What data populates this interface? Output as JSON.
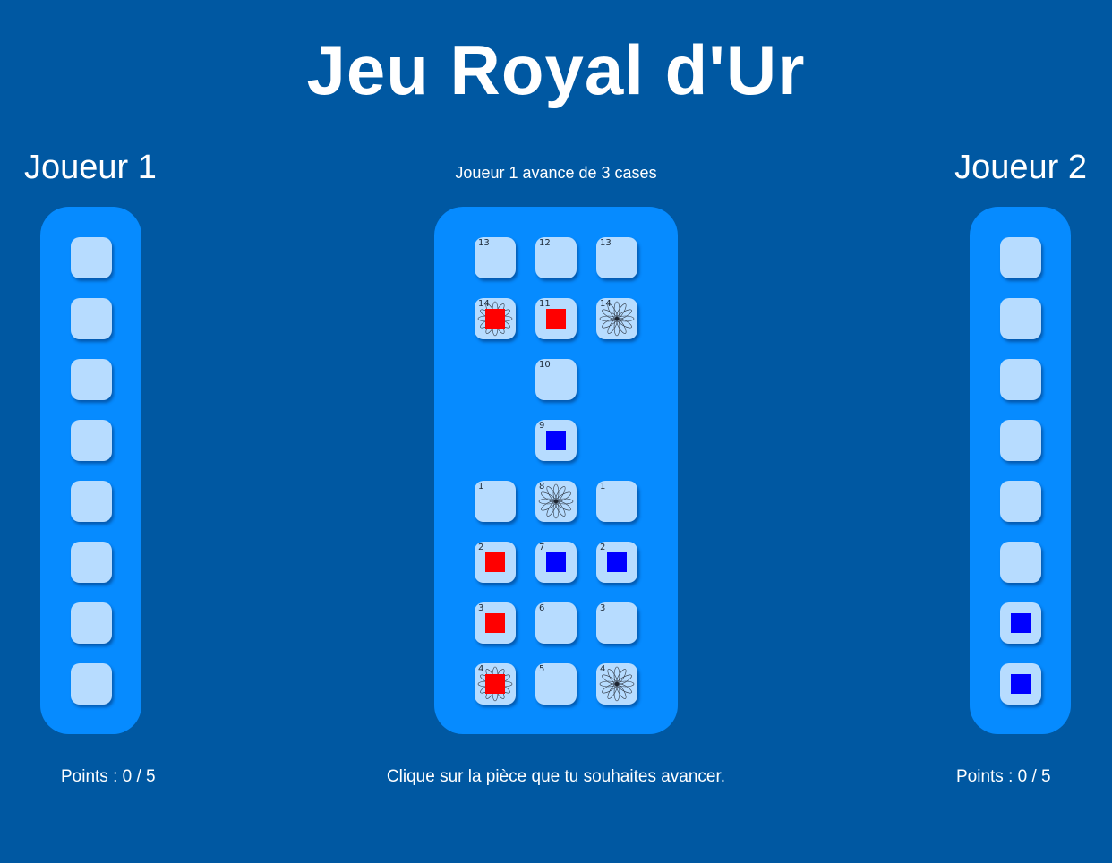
{
  "title": "Jeu Royal d'Ur",
  "status": "Joueur 1 avance de 3 cases",
  "hint": "Clique sur la pièce que tu souhaites avancer.",
  "colors": {
    "background": "#0058a2",
    "panel": "#068bff",
    "cell": "#b7dcff",
    "player1_piece": "#ff0000",
    "player2_piece": "#0000ff"
  },
  "players": [
    {
      "name": "Joueur 1",
      "points_label": "Points : 0 / 5",
      "reserve": [
        "empty",
        "empty",
        "empty",
        "empty",
        "empty",
        "empty",
        "empty",
        "empty"
      ]
    },
    {
      "name": "Joueur 2",
      "points_label": "Points : 0 / 5",
      "reserve": [
        "empty",
        "empty",
        "empty",
        "empty",
        "empty",
        "empty",
        "blue",
        "blue"
      ]
    }
  ],
  "board": {
    "rows": [
      [
        {
          "num": "13",
          "rosette": false,
          "piece": null
        },
        {
          "num": "12",
          "rosette": false,
          "piece": null
        },
        {
          "num": "13",
          "rosette": false,
          "piece": null
        }
      ],
      [
        {
          "num": "14",
          "rosette": true,
          "piece": "red"
        },
        {
          "num": "11",
          "rosette": false,
          "piece": "red"
        },
        {
          "num": "14",
          "rosette": true,
          "piece": null
        }
      ],
      [
        null,
        {
          "num": "10",
          "rosette": false,
          "piece": null
        },
        null
      ],
      [
        null,
        {
          "num": "9",
          "rosette": false,
          "piece": "blue"
        },
        null
      ],
      [
        {
          "num": "1",
          "rosette": false,
          "piece": null
        },
        {
          "num": "8",
          "rosette": true,
          "piece": null
        },
        {
          "num": "1",
          "rosette": false,
          "piece": null
        }
      ],
      [
        {
          "num": "2",
          "rosette": false,
          "piece": "red"
        },
        {
          "num": "7",
          "rosette": false,
          "piece": "blue"
        },
        {
          "num": "2",
          "rosette": false,
          "piece": "blue"
        }
      ],
      [
        {
          "num": "3",
          "rosette": false,
          "piece": "red"
        },
        {
          "num": "6",
          "rosette": false,
          "piece": null
        },
        {
          "num": "3",
          "rosette": false,
          "piece": null
        }
      ],
      [
        {
          "num": "4",
          "rosette": true,
          "piece": "red"
        },
        {
          "num": "5",
          "rosette": false,
          "piece": null
        },
        {
          "num": "4",
          "rosette": true,
          "piece": null
        }
      ]
    ]
  }
}
